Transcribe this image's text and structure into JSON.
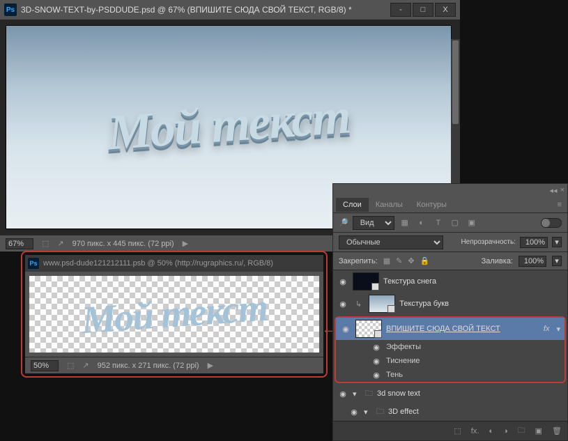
{
  "titlebar": {
    "title": "3D-SNOW-TEXT-by-PSDDUDE.psd @ 67% (ВПИШИТЕ СЮДА СВОЙ ТЕКСТ, RGB/8) *",
    "minimize": "-",
    "maximize": "□",
    "close": "X"
  },
  "canvas": {
    "main_text": "Мой текст"
  },
  "status": {
    "zoom_main": "67%",
    "info_main": "970 пикс. x 445 пикс. (72 ppi)"
  },
  "second": {
    "tab_title": "www.psd-dude121212111.psb @ 50% (http://rugraphics.ru/, RGB/8)",
    "canvas_text": "Мой текст",
    "zoom": "50%",
    "info": "952 пикс. x 271 пикс. (72 ppi)"
  },
  "panel": {
    "tabs": {
      "layers": "Слои",
      "channels": "Каналы",
      "paths": "Контуры"
    },
    "filter_label": "Вид",
    "blend_mode": "Обычные",
    "opacity_label": "Непрозрачность:",
    "opacity_value": "100%",
    "lock_label": "Закрепить:",
    "fill_label": "Заливка:",
    "fill_value": "100%"
  },
  "layers": {
    "snow_texture": "Текстура снега",
    "letters_texture": "Текстура букв",
    "type_here": "ВПИШИТЕ СЮДА СВОЙ ТЕКСТ",
    "effects": "Эффекты",
    "emboss": "Тиснение",
    "shadow": "Тень",
    "group1": "3d snow text",
    "group2": "3D effect",
    "fx": "fx"
  },
  "icons": {
    "search": "🔍",
    "link": "⬚",
    "fx_footer": "fx.",
    "mask": "◐",
    "fill": "◑",
    "folder": "🗀",
    "new": "▣",
    "trash": "🗑",
    "eye": "👁",
    "lock": "🔒",
    "move": "✥",
    "brush": "✎",
    "pixel": "⬚"
  }
}
